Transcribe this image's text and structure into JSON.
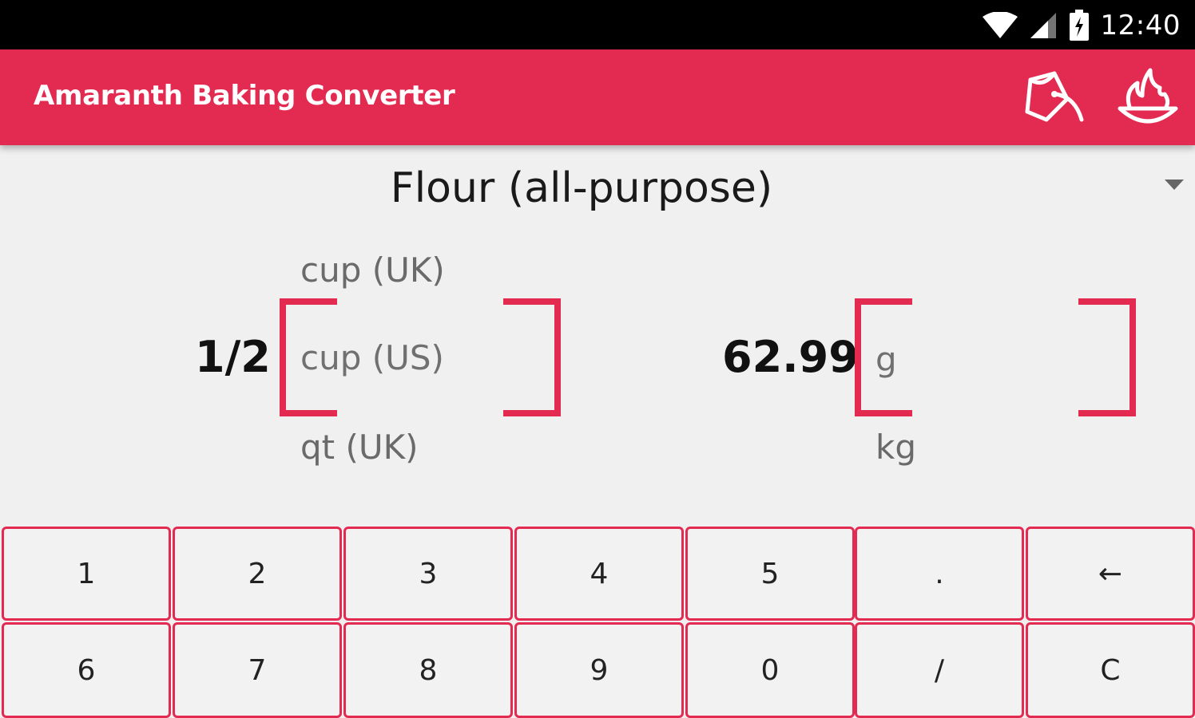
{
  "status_bar": {
    "time": "12:40"
  },
  "app_bar": {
    "title": "Amaranth Baking Converter",
    "action_icons": [
      "pouring-cup-icon",
      "bowl-flame-icon"
    ]
  },
  "ingredient": {
    "selected": "Flour (all-purpose)"
  },
  "from": {
    "amount": "1/2",
    "unit_above": "cup (UK)",
    "unit_selected": "cup (US)",
    "unit_below": "qt (UK)"
  },
  "to": {
    "amount": "62.99",
    "unit_selected": "g",
    "unit_below": "kg"
  },
  "keypad": {
    "row1": [
      "1",
      "2",
      "3",
      "4",
      "5",
      ".",
      "←"
    ],
    "row2": [
      "6",
      "7",
      "8",
      "9",
      "0",
      "/",
      "C"
    ]
  },
  "colors": {
    "accent": "#e32a51",
    "background": "#f0f0f0",
    "status_bar": "#000000"
  }
}
